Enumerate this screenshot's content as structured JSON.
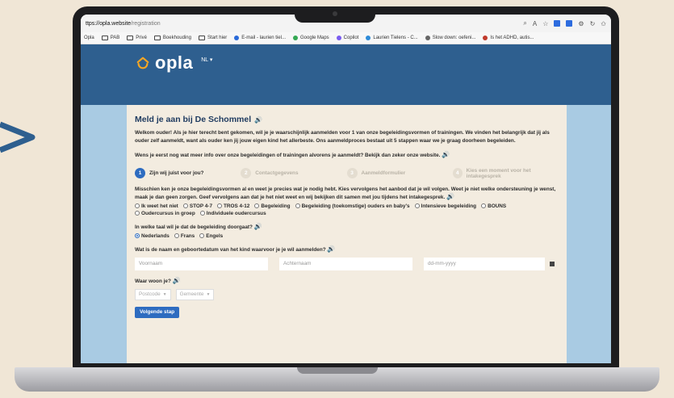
{
  "browser": {
    "url_host": "ttps://opla.website",
    "url_path": "/registration",
    "bookmarks": [
      {
        "label": "Opla",
        "kind": "text"
      },
      {
        "label": "PAB",
        "kind": "folder"
      },
      {
        "label": "Privé",
        "kind": "folder"
      },
      {
        "label": "Boekhouding",
        "kind": "folder"
      },
      {
        "label": "Start hier",
        "kind": "folder"
      },
      {
        "label": "E-mail - laurien tiel...",
        "kind": "site",
        "color": "#2a6ad9"
      },
      {
        "label": "Google Maps",
        "kind": "site",
        "color": "#34a853"
      },
      {
        "label": "Copilot",
        "kind": "site",
        "color": "#7a5cf0"
      },
      {
        "label": "Laurien Tielens - C...",
        "kind": "site",
        "color": "#2e8bd8"
      },
      {
        "label": "Slow down: oefeni...",
        "kind": "site",
        "color": "#666666"
      },
      {
        "label": "Is het ADHD, autis...",
        "kind": "site",
        "color": "#c0392b"
      }
    ]
  },
  "site": {
    "logo_text": "opla",
    "lang": "NL ▾"
  },
  "form": {
    "title": "Meld je aan bij De Schommel",
    "intro": "Welkom ouder! Als je hier terecht bent gekomen, wil je je waarschijnlijk aanmelden voor 1 van onze begeleidingsvormen of trainingen. We vinden het belangrijk dat jij als ouder zelf aanmeldt, want als ouder ken jij jouw eigen kind het allerbeste. Ons aanmeldproces bestaat uit 5 stappen waar we je graag doorheen begeleiden.",
    "info": "Wens je eerst nog wat meer info over onze begeleidingen of trainingen alvorens je aanmeldt? Bekijk dan zeker onze website.",
    "steps": [
      {
        "num": "1",
        "label": "Zijn wij juist voor jou?"
      },
      {
        "num": "2",
        "label": "Contactgegevens"
      },
      {
        "num": "3",
        "label": "Aanmeldformulier"
      },
      {
        "num": "4",
        "label": "Kies een moment voor het intakegesprek"
      }
    ],
    "offer_text": "Misschien ken je onze begeleidingsvormen al en weet je precies wat je nodig hebt. Kies vervolgens het aanbod dat je wil volgen. Weet je niet welke ondersteuning je wenst, maak je dan geen zorgen. Geef vervolgens aan dat je het niet weet en wij bekijken dit samen met jou tijdens het intakegesprek.",
    "offer_options": [
      "Ik weet het niet",
      "STOP 4-7",
      "TROS 4-12",
      "Begeleiding",
      "Begeleiding (toekomstige) ouders en baby's",
      "Intensieve begeleiding",
      "BOUNS",
      "Oudercursus in groep",
      "Individuele oudercursus"
    ],
    "lang_question": "In welke taal wil je dat de begeleiding doorgaat?",
    "lang_options": [
      "Nederlands",
      "Frans",
      "Engels"
    ],
    "lang_selected": "Nederlands",
    "child_question": "Wat is de naam en geboortedatum van het kind waarvoor je je wil aanmelden?",
    "firstname_placeholder": "Voornaam",
    "lastname_placeholder": "Achternaam",
    "date_placeholder": "dd-mm-yyyy",
    "address_question": "Waar woon je?",
    "postcode_label": "Postcode",
    "gemeente_label": "Gemeente",
    "next_button": "Volgende stap"
  },
  "colors": {
    "header": "#2e5f8f",
    "accent": "#2e6cc0",
    "card": "#f3ece0",
    "side": "#a9cbe3"
  }
}
